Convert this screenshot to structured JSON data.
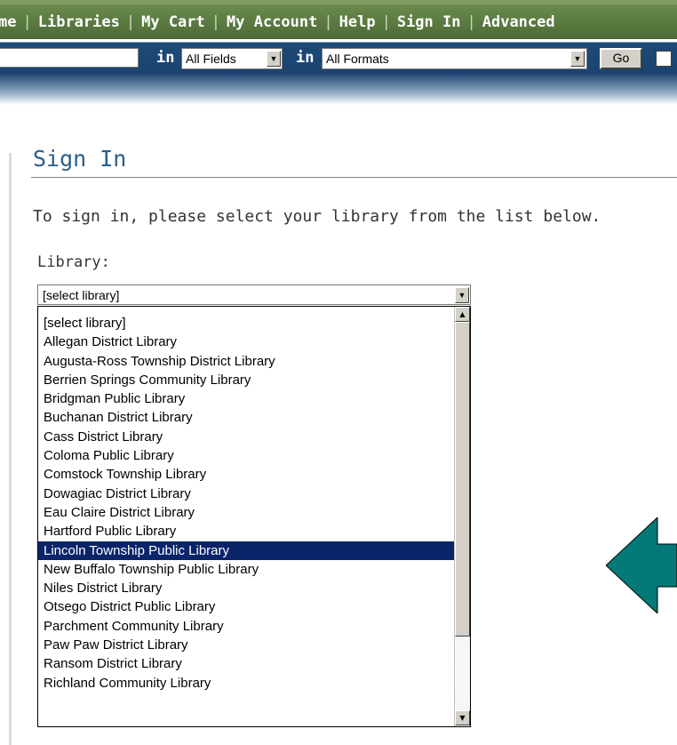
{
  "nav": {
    "items": [
      "me",
      "Libraries",
      "My Cart",
      "My Account",
      "Help",
      "Sign In",
      "Advanced"
    ]
  },
  "search": {
    "in_label_1": "in",
    "field_select": "All Fields",
    "in_label_2": "in",
    "format_select": "All Formats",
    "go_label": "Go"
  },
  "main": {
    "title": "Sign In",
    "instruction": "To sign in, please select your library from the list below.",
    "library_label": "Library:",
    "library_select_value": "[select library]",
    "library_options": [
      "[select library]",
      "Allegan District Library",
      "Augusta-Ross Township District Library",
      "Berrien Springs Community Library",
      "Bridgman Public Library",
      "Buchanan District Library",
      "Cass District Library",
      "Coloma Public Library",
      "Comstock Township Library",
      "Dowagiac District Library",
      "Eau Claire District Library",
      "Hartford Public Library",
      "Lincoln Township Public Library",
      "New Buffalo Township Public Library",
      "Niles District Library",
      "Otsego District Public Library",
      "Parchment Community Library",
      "Paw Paw District Library",
      "Ransom District Library",
      "Richland Community Library"
    ],
    "highlighted_option": "Lincoln Township Public Library"
  },
  "colors": {
    "nav_green": "#5a7a42",
    "search_blue": "#1b4370",
    "title_blue": "#2a5d87",
    "highlight": "#0a246a",
    "arrow_teal": "#047a78"
  }
}
